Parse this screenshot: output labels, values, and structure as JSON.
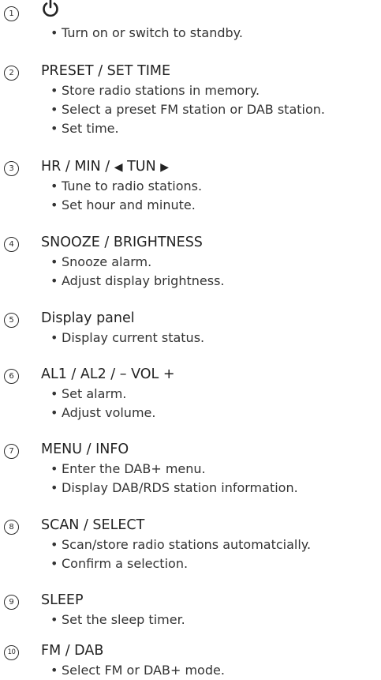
{
  "items": [
    {
      "number": "1",
      "title": "",
      "title_icon": "power-icon",
      "bullets": [
        "Turn on or switch to standby."
      ]
    },
    {
      "number": "2",
      "title": "PRESET / SET TIME",
      "bullets": [
        "Store radio stations in memory.",
        "Select a preset FM station or DAB station.",
        "Set time."
      ]
    },
    {
      "number": "3",
      "title_parts": [
        "HR / MIN / ",
        "TUN",
        ""
      ],
      "title_icons": [
        "left-triangle-icon",
        "right-triangle-icon"
      ],
      "bullets": [
        "Tune to radio stations.",
        "Set hour and minute."
      ]
    },
    {
      "number": "4",
      "title": "SNOOZE / BRIGHTNESS",
      "bullets": [
        "Snooze alarm.",
        "Adjust display brightness."
      ]
    },
    {
      "number": "5",
      "title": "Display panel",
      "bullets": [
        "Display current status."
      ]
    },
    {
      "number": "6",
      "title": "AL1 / AL2 / – VOL +",
      "bullets": [
        "Set alarm.",
        "Adjust volume."
      ]
    },
    {
      "number": "7",
      "title": "MENU / INFO",
      "bullets": [
        "Enter the DAB+ menu.",
        "Display DAB/RDS station information."
      ]
    },
    {
      "number": "8",
      "title": "SCAN / SELECT",
      "bullets": [
        "Scan/store radio stations automatcially.",
        "Confirm a selection."
      ]
    },
    {
      "number": "9",
      "title": "SLEEP",
      "bullets": [
        "Set the sleep timer."
      ]
    },
    {
      "number": "10",
      "title": "FM / DAB",
      "bullets": [
        "Select FM or DAB+ mode."
      ]
    }
  ]
}
